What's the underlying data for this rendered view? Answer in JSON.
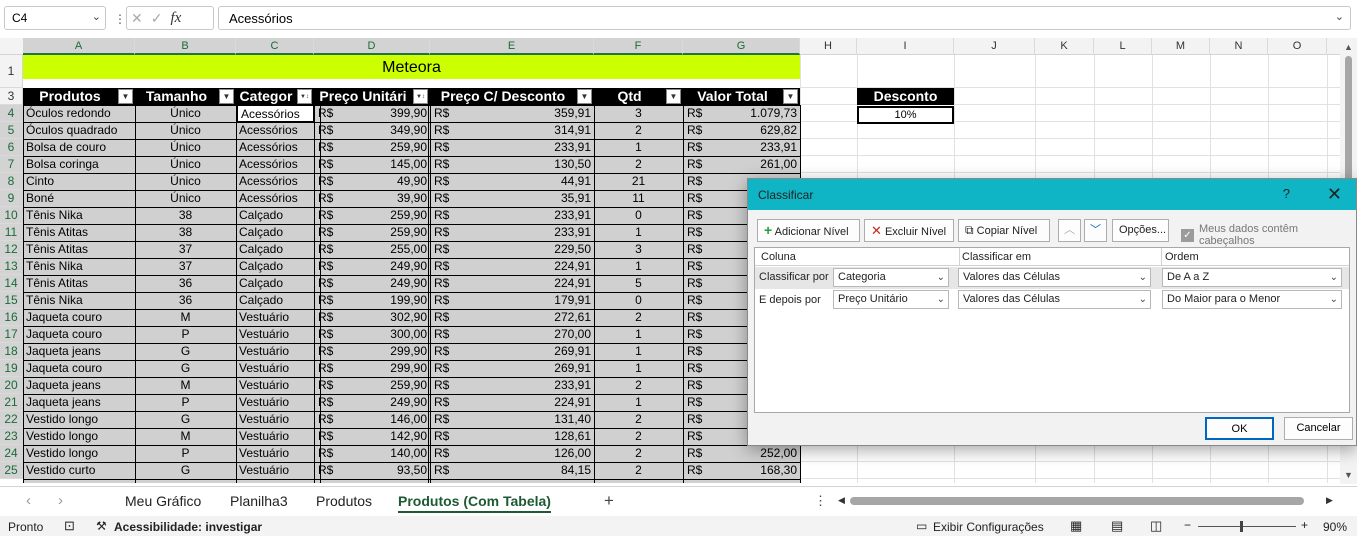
{
  "formula_bar": {
    "cell_ref": "C4",
    "value": "Acessórios"
  },
  "columns": [
    "A",
    "B",
    "C",
    "D",
    "E",
    "F",
    "G",
    "H",
    "I",
    "J",
    "K",
    "L",
    "M",
    "N",
    "O"
  ],
  "rows": [
    "1",
    "3",
    "4",
    "5",
    "6",
    "7",
    "8",
    "9",
    "10",
    "11",
    "12",
    "13",
    "14",
    "15",
    "16",
    "17",
    "18",
    "19",
    "20",
    "21",
    "22",
    "23",
    "24",
    "25"
  ],
  "sheet": {
    "title": "Meteora",
    "headers": [
      "Produtos",
      "Tamanho",
      "Categor",
      "Preço Unitári",
      "Preço C/ Desconto",
      "Qtd",
      "Valor Total"
    ],
    "currency": "R$",
    "data": [
      [
        "Óculos redondo",
        "Único",
        "Acessórios",
        "399,90",
        "359,91",
        "3",
        "1.079,73"
      ],
      [
        "Óculos quadrado",
        "Único",
        "Acessórios",
        "349,90",
        "314,91",
        "2",
        "629,82"
      ],
      [
        "Bolsa de couro",
        "Único",
        "Acessórios",
        "259,90",
        "233,91",
        "1",
        "233,91"
      ],
      [
        "Bolsa coringa",
        "Único",
        "Acessórios",
        "145,00",
        "130,50",
        "2",
        "261,00"
      ],
      [
        "Cinto",
        "Único",
        "Acessórios",
        "49,90",
        "44,91",
        "21",
        ""
      ],
      [
        "Boné",
        "Único",
        "Acessórios",
        "39,90",
        "35,91",
        "11",
        ""
      ],
      [
        "Tênis Nika",
        "38",
        "Calçado",
        "259,90",
        "233,91",
        "0",
        ""
      ],
      [
        "Tênis Atitas",
        "38",
        "Calçado",
        "259,90",
        "233,91",
        "1",
        ""
      ],
      [
        "Tênis Atitas",
        "37",
        "Calçado",
        "255,00",
        "229,50",
        "3",
        ""
      ],
      [
        "Tênis Nika",
        "37",
        "Calçado",
        "249,90",
        "224,91",
        "1",
        ""
      ],
      [
        "Tênis Atitas",
        "36",
        "Calçado",
        "249,90",
        "224,91",
        "5",
        ""
      ],
      [
        "Tênis Nika",
        "36",
        "Calçado",
        "199,90",
        "179,91",
        "0",
        ""
      ],
      [
        "Jaqueta couro",
        "M",
        "Vestuário",
        "302,90",
        "272,61",
        "2",
        ""
      ],
      [
        "Jaqueta couro",
        "P",
        "Vestuário",
        "300,00",
        "270,00",
        "1",
        ""
      ],
      [
        "Jaqueta jeans",
        "G",
        "Vestuário",
        "299,90",
        "269,91",
        "1",
        ""
      ],
      [
        "Jaqueta couro",
        "G",
        "Vestuário",
        "299,90",
        "269,91",
        "1",
        ""
      ],
      [
        "Jaqueta jeans",
        "M",
        "Vestuário",
        "259,90",
        "233,91",
        "2",
        ""
      ],
      [
        "Jaqueta jeans",
        "P",
        "Vestuário",
        "249,90",
        "224,91",
        "1",
        ""
      ],
      [
        "Vestido longo",
        "G",
        "Vestuário",
        "146,00",
        "131,40",
        "2",
        ""
      ],
      [
        "Vestido longo",
        "M",
        "Vestuário",
        "142,90",
        "128,61",
        "2",
        ""
      ],
      [
        "Vestido longo",
        "P",
        "Vestuário",
        "140,00",
        "126,00",
        "2",
        "252,00"
      ],
      [
        "Vestido curto",
        "G",
        "Vestuário",
        "93,50",
        "84,15",
        "2",
        "168,30"
      ]
    ],
    "discount_label": "Desconto",
    "discount_value": "10%"
  },
  "dialog": {
    "title": "Classificar",
    "help": "?",
    "close": "✕",
    "add_level": "Adicionar Nível",
    "delete_level": "Excluir Nível",
    "copy_level": "Copiar Nível",
    "options": "Opções...",
    "headers_checkbox": "Meus dados contêm cabeçalhos",
    "col_header": "Coluna",
    "sort_on_header": "Classificar em",
    "order_header": "Ordem",
    "levels": [
      {
        "label": "Classificar por",
        "column": "Categoria",
        "sort_on": "Valores das Células",
        "order": "De A a Z"
      },
      {
        "label": "E depois por",
        "column": "Preço Unitário",
        "sort_on": "Valores das Células",
        "order": "Do Maior para o Menor"
      }
    ],
    "ok": "OK",
    "cancel": "Cancelar"
  },
  "tabs": [
    "Meu Gráfico",
    "Planilha3",
    "Produtos",
    "Produtos (Com Tabela)"
  ],
  "add_sheet": "+",
  "status": {
    "ready": "Pronto",
    "accessibility": "Acessibilidade: investigar",
    "display_settings": "Exibir Configurações",
    "zoom": "90%",
    "zoom_minus": "−",
    "zoom_plus": "+"
  }
}
